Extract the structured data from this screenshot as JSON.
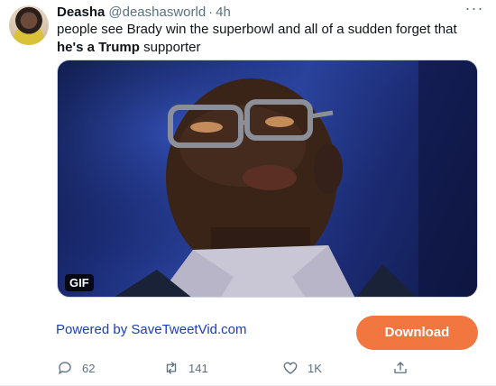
{
  "tweet": {
    "author_name": "Deasha",
    "author_handle": "@deashasworld",
    "separator": "·",
    "timestamp": "4h",
    "text_before": "people see Brady win the superbowl and all of a sudden forget that ",
    "text_bold": "he's a Trump",
    "text_after": " supporter",
    "media_badge": "GIF"
  },
  "promo": {
    "powered_by": "Powered by SaveTweetVid.com",
    "download_label": "Download",
    "download_color": "#f2763f",
    "link_color": "#1a3fb5"
  },
  "actions": {
    "replies": "62",
    "retweets": "141",
    "likes": "1K"
  },
  "icons": {
    "more": "more-dots-icon",
    "reply": "reply-icon",
    "retweet": "retweet-icon",
    "like": "heart-icon",
    "share": "share-icon"
  }
}
